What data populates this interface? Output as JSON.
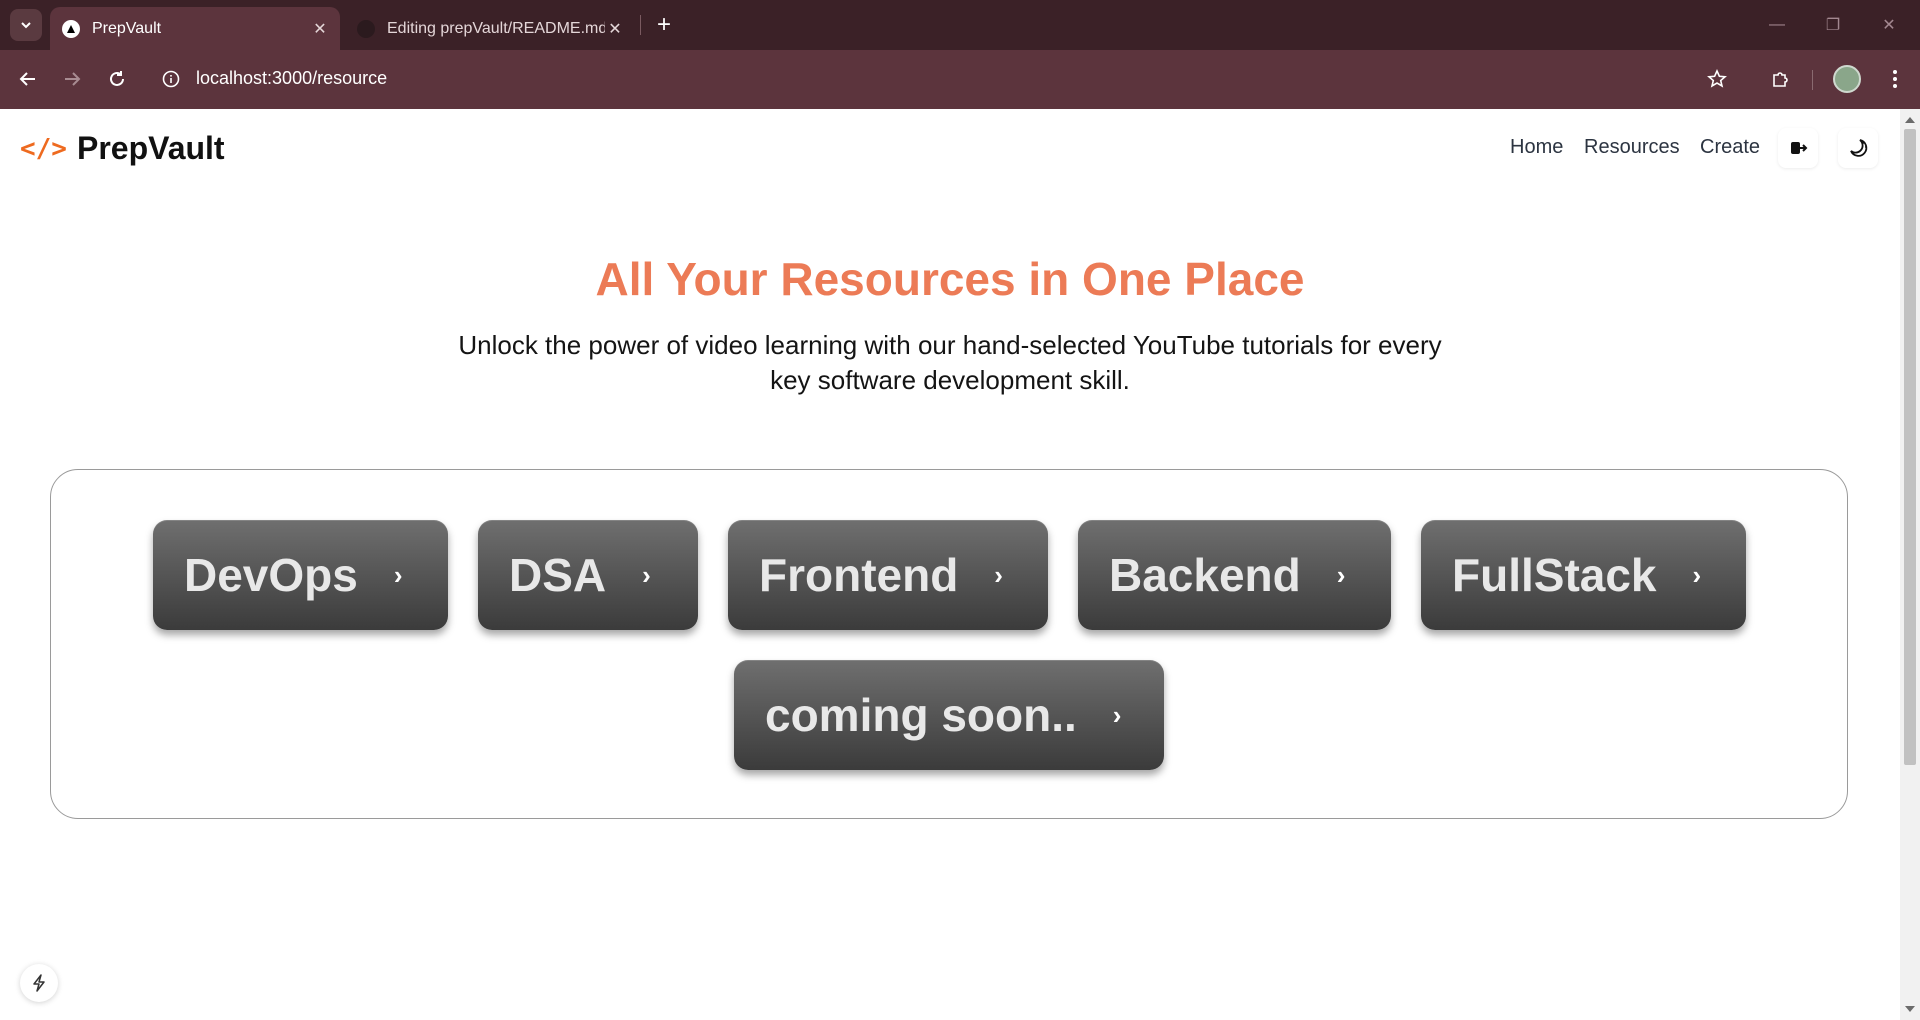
{
  "browser": {
    "tabs": [
      {
        "title": "PrepVault",
        "active": true,
        "icon": "nextjs-icon"
      },
      {
        "title": "Editing prepVault/README.md",
        "active": false,
        "icon": "github-icon"
      }
    ],
    "url": "localhost:3000/resource"
  },
  "site": {
    "brand_mark": "</>",
    "brand_name": "PrepVault",
    "nav": {
      "home": "Home",
      "resources": "Resources",
      "create": "Create"
    }
  },
  "hero": {
    "title": "All Your Resources in One Place",
    "subtitle": "Unlock the power of video learning with our hand-selected YouTube tutorials for every key software development skill."
  },
  "categories": [
    "DevOps",
    "DSA",
    "Frontend",
    "Backend",
    "FullStack",
    "coming soon.."
  ],
  "colors": {
    "accent": "#ec7b56",
    "brand_mark": "#ee6a1f",
    "button_top": "#6f6f6f",
    "button_bottom": "#3b3b3b",
    "chrome": "#5c343d"
  }
}
